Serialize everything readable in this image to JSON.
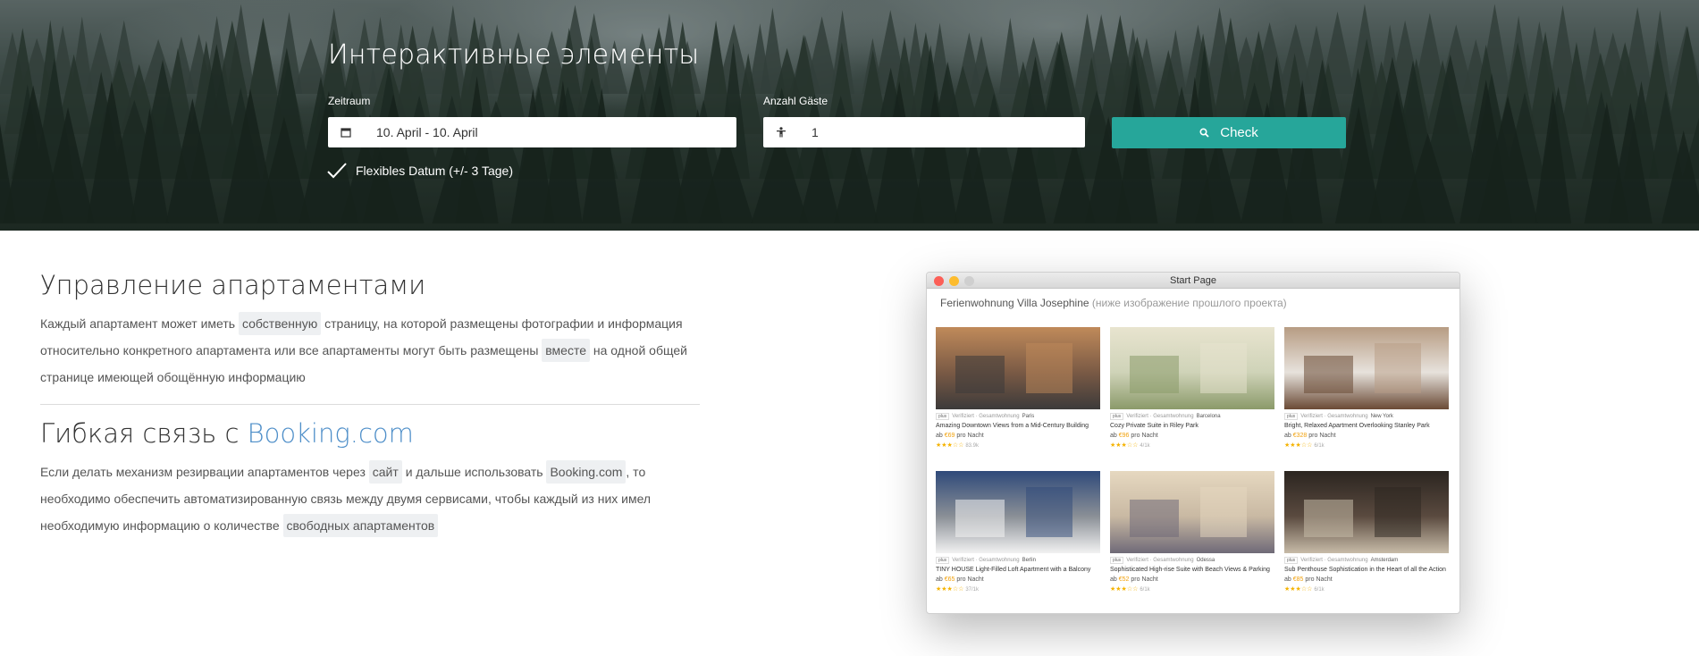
{
  "hero": {
    "title": "Интерактивные элементы",
    "period_label": "Zeitraum",
    "period_value": "10. April - 10. April",
    "guests_label": "Anzahl Gäste",
    "guests_value": "1",
    "check_label": "Check",
    "flexible_label": "Flexibles Datum (+/- 3 Tage)",
    "icons": {
      "period": "calendar-icon",
      "guests": "person-icon",
      "check": "search-icon",
      "flexible": "checkmark-icon"
    },
    "accent_color": "#26a69a"
  },
  "section1": {
    "title": "Управление апартаментами",
    "p_a": "Каждый апартамент может иметь",
    "chip_1": "собственную",
    "p_b": "страницу, на которой размещены фотографии и информация относительно конкретного апартамента или все апартаменты могут быть размещены",
    "chip_2": "вместе",
    "p_c": "на одной общей странице имеющей обощённую информацию"
  },
  "section2": {
    "title_prefix": "Гибкая связь с",
    "title_link": "Booking.com",
    "link_color": "#4f8fc9",
    "p_a": "Если делать механизм резирвации апартаментов через",
    "chip_1": "сайт",
    "p_b": "и дальше использовать",
    "chip_2": "Booking.com",
    "p_c": ", то необходимо обеспечить автоматизированную связь между двумя сервисами, чтобы каждый из них имел необходимую информацию о количестве",
    "chip_3": "свободных апартаментов"
  },
  "preview": {
    "window_title": "Start Page",
    "heading": "Ferienwohnung Villa Josephine",
    "heading_note": "(ниже изображение прошлого проекта)",
    "cards": [
      {
        "pill": "plus",
        "type": "Verifiziert · Gesamtwohnung",
        "city": "Paris",
        "title": "Amazing Downtown Views from a Mid-Century Building",
        "price_prefix": "ab",
        "price": "€69",
        "price_suffix": "pro Nacht",
        "stars": "★★★☆☆",
        "reviews": "83.9k"
      },
      {
        "pill": "plus",
        "type": "Verifiziert · Gesamtwohnung",
        "city": "Barcelona",
        "title": "Cozy Private Suite in Riley Park",
        "price_prefix": "ab",
        "price": "€96",
        "price_suffix": "pro Nacht",
        "stars": "★★★☆☆",
        "reviews": "4/1k"
      },
      {
        "pill": "plus",
        "type": "Verifiziert · Gesamtwohnung",
        "city": "New York",
        "title": "Bright, Relaxed Apartment Overlooking Stanley Park",
        "price_prefix": "ab",
        "price": "€328",
        "price_suffix": "pro Nacht",
        "stars": "★★★☆☆",
        "reviews": "6/1k"
      },
      {
        "pill": "plus",
        "type": "Verifiziert · Gesamtwohnung",
        "city": "Berlin",
        "title": "TINY HOUSE Light-Filled Loft Apartment with a Balcony",
        "price_prefix": "ab",
        "price": "€65",
        "price_suffix": "pro Nacht",
        "stars": "★★★☆☆",
        "reviews": "37/1k"
      },
      {
        "pill": "plus",
        "type": "Verifiziert · Gesamtwohnung",
        "city": "Odessa",
        "title": "Sophisticated High-rise Suite with Beach Views & Parking",
        "price_prefix": "ab",
        "price": "€52",
        "price_suffix": "pro Nacht",
        "stars": "★★★☆☆",
        "reviews": "6/1k"
      },
      {
        "pill": "plus",
        "type": "Verifiziert · Gesamtwohnung",
        "city": "Amsterdam",
        "title": "Sub Penthouse Sophistication in the Heart of all the Action",
        "price_prefix": "ab",
        "price": "€85",
        "price_suffix": "pro Nacht",
        "stars": "★★★☆☆",
        "reviews": "6/1k"
      }
    ]
  }
}
